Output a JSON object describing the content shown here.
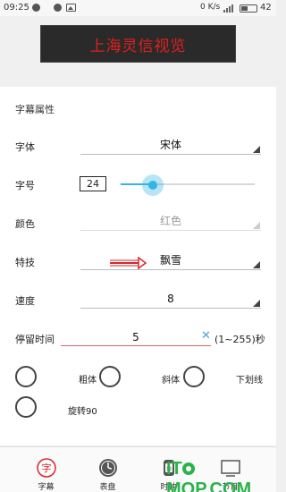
{
  "status_bar": {
    "time": "09:25",
    "network_speed": "0 K/s",
    "battery_level": "42"
  },
  "banner": {
    "text": "上海灵信视览"
  },
  "form": {
    "section_title": "字幕属性",
    "font": {
      "label": "字体",
      "value": "宋体"
    },
    "size": {
      "label": "字号",
      "value": "24",
      "slider_fraction": 0.24
    },
    "color": {
      "label": "颜色",
      "value": "红色"
    },
    "effect": {
      "label": "特技",
      "value": "飘雪"
    },
    "speed": {
      "label": "速度",
      "value": "8"
    },
    "dwell": {
      "label": "停留时间",
      "value": "5",
      "range_hint": "(1~255)秒",
      "clear_icon": "✕"
    },
    "styles": [
      {
        "label": "粗体",
        "checked": false
      },
      {
        "label": "斜体",
        "checked": false
      },
      {
        "label": "下划线",
        "checked": false
      },
      {
        "label": "旋转90",
        "checked": false
      }
    ]
  },
  "tabs": [
    {
      "label": "字幕",
      "icon": "subtitle-icon"
    },
    {
      "label": "表盘",
      "icon": "dial-icon"
    },
    {
      "label": "时钟",
      "icon": "clock-icon"
    },
    {
      "label": "节目",
      "icon": "program-icon"
    }
  ],
  "watermark": {
    "text_left": "IT",
    "text_right": "MOP.COM"
  },
  "colors": {
    "banner_text": "#e0201e",
    "accent": "#33b5e5",
    "arrow": "#d9262b",
    "tab_active": "#d9262b",
    "watermark": "#2bb24c"
  }
}
